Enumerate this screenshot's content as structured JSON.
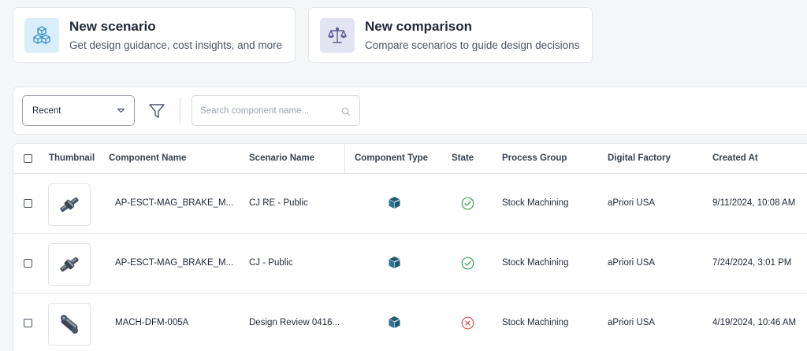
{
  "cards": [
    {
      "title": "New scenario",
      "subtitle": "Get design guidance, cost insights, and more",
      "icon": "cubes-icon"
    },
    {
      "title": "New comparison",
      "subtitle": "Compare scenarios to guide design decisions",
      "icon": "scale-icon"
    }
  ],
  "toolbar": {
    "sort_value": "Recent",
    "search_placeholder": "Search component name..."
  },
  "table": {
    "columns": [
      "Thumbnail",
      "Component Name",
      "Scenario Name",
      "Component Type",
      "State",
      "Process Group",
      "Digital Factory",
      "Created At"
    ],
    "rows": [
      {
        "component": "AP-ESCT-MAG_BRAKE_M...",
        "scenario": "CJ RE - Public",
        "type": "part-cube-icon",
        "state": "success",
        "process": "Stock Machining",
        "factory": "aPriori USA",
        "created": "9/11/2024, 10:08 AM"
      },
      {
        "component": "AP-ESCT-MAG_BRAKE_M...",
        "scenario": "CJ - Public",
        "type": "part-cube-icon",
        "state": "success",
        "process": "Stock Machining",
        "factory": "aPriori USA",
        "created": "7/24/2024, 3:01 PM"
      },
      {
        "component": "MACH-DFM-005A",
        "scenario": "Design Review 0416...",
        "type": "part-cube-icon",
        "state": "failed",
        "process": "Stock Machining",
        "factory": "aPriori USA",
        "created": "4/19/2024, 10:46 AM"
      }
    ]
  },
  "colors": {
    "success": "#3fa25a",
    "failed": "#d9534f",
    "partIcon": "#1f5a70",
    "scenarioIcon": "#2f8fc7",
    "comparisonIcon": "#5b5f8e"
  }
}
